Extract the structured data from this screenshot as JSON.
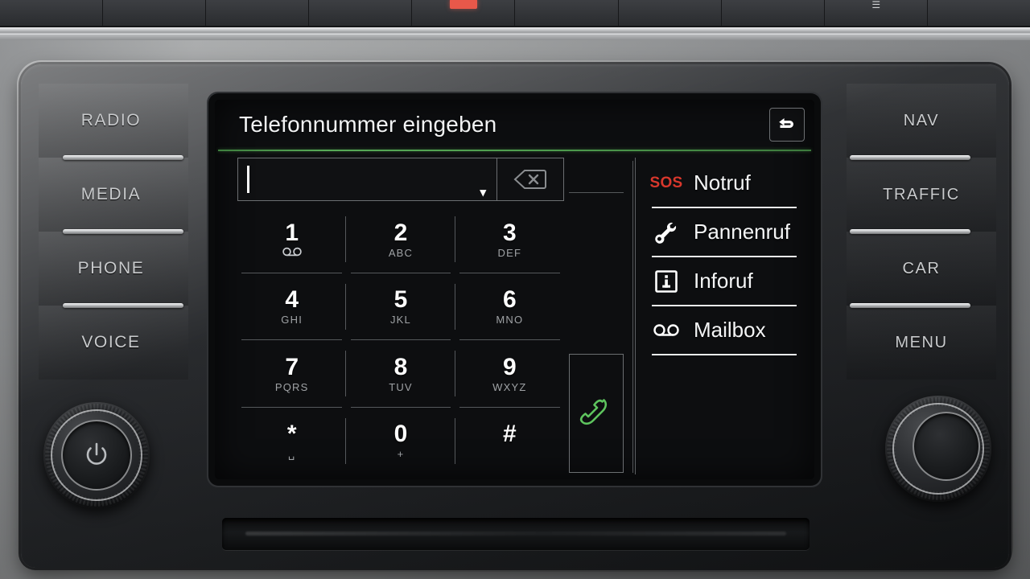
{
  "dashboard": {
    "top_strip": {
      "keys": [
        {
          "name": "blank-key-1",
          "glyph": ""
        },
        {
          "name": "blank-key-2",
          "glyph": ""
        },
        {
          "name": "blank-key-3",
          "glyph": ""
        },
        {
          "name": "blank-key-4",
          "glyph": ""
        },
        {
          "name": "hazard-lights-key",
          "glyph": ""
        },
        {
          "name": "blank-key-5",
          "glyph": ""
        },
        {
          "name": "blank-key-6",
          "glyph": ""
        },
        {
          "name": "blank-key-7",
          "glyph": ""
        },
        {
          "name": "rear-defrost-key",
          "glyph": ""
        },
        {
          "name": "blank-key-8",
          "glyph": ""
        }
      ]
    },
    "left_buttons": [
      {
        "label": "RADIO"
      },
      {
        "label": "MEDIA"
      },
      {
        "label": "PHONE"
      },
      {
        "label": "VOICE"
      }
    ],
    "right_buttons": [
      {
        "label": "NAV"
      },
      {
        "label": "TRAFFIC"
      },
      {
        "label": "CAR"
      },
      {
        "label": "MENU"
      }
    ],
    "knobs": {
      "left": {
        "name": "power-volume-knob",
        "symbol": "power-icon"
      },
      "right": {
        "name": "tune-scroll-knob",
        "symbol": ""
      }
    },
    "media_slot": {
      "name": "cd-slot"
    }
  },
  "screen": {
    "title": "Telefonnummer eingeben",
    "accent_color": "#4e9c4e",
    "background_color": "#0d0e10",
    "back_button": {
      "icon": "back-arrow-icon"
    },
    "input": {
      "value": "",
      "placeholder": "",
      "dropdown_icon": "chevron-down-icon",
      "delete_button": {
        "icon": "backspace-delete-icon"
      }
    },
    "keypad": [
      {
        "digit": "1",
        "sub": "",
        "sub_icon": "voicemail-icon"
      },
      {
        "digit": "2",
        "sub": "ABC",
        "sub_icon": ""
      },
      {
        "digit": "3",
        "sub": "DEF",
        "sub_icon": ""
      },
      {
        "digit": "4",
        "sub": "GHI",
        "sub_icon": ""
      },
      {
        "digit": "5",
        "sub": "JKL",
        "sub_icon": ""
      },
      {
        "digit": "6",
        "sub": "MNO",
        "sub_icon": ""
      },
      {
        "digit": "7",
        "sub": "PQRS",
        "sub_icon": ""
      },
      {
        "digit": "8",
        "sub": "TUV",
        "sub_icon": ""
      },
      {
        "digit": "9",
        "sub": "WXYZ",
        "sub_icon": ""
      },
      {
        "digit": "*",
        "sub": "␣",
        "sub_icon": ""
      },
      {
        "digit": "0",
        "sub": "+",
        "sub_icon": ""
      },
      {
        "digit": "#",
        "sub": "",
        "sub_icon": ""
      }
    ],
    "call_button": {
      "icon": "phone-handset-icon",
      "color": "#5ec45e"
    },
    "service_list": [
      {
        "label": "Notruf",
        "icon": "sos-icon",
        "icon_text": "SOS",
        "icon_color": "#d8372c"
      },
      {
        "label": "Pannenruf",
        "icon": "wrench-icon",
        "icon_text": "",
        "icon_color": "#ffffff"
      },
      {
        "label": "Inforuf",
        "icon": "info-box-icon",
        "icon_text": "",
        "icon_color": "#ffffff"
      },
      {
        "label": "Mailbox",
        "icon": "voicemail-icon",
        "icon_text": "",
        "icon_color": "#ffffff"
      }
    ]
  }
}
